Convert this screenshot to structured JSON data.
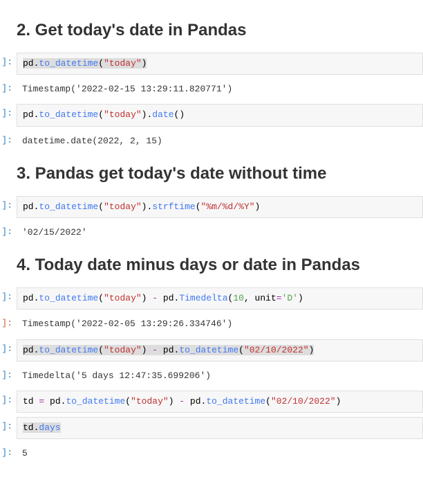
{
  "sections": [
    {
      "heading": "2. Get today's date in Pandas",
      "cells": [
        {
          "type": "in",
          "prompt": "]:",
          "highlighted": true,
          "tokens": [
            {
              "t": "pd",
              "c": "tok-k"
            },
            {
              "t": ".",
              "c": "tok-k"
            },
            {
              "t": "to_datetime",
              "c": "tok-fn"
            },
            {
              "t": "(",
              "c": "tok-k"
            },
            {
              "t": "\"today\"",
              "c": "tok-s"
            },
            {
              "t": ")",
              "c": "tok-k"
            }
          ]
        },
        {
          "type": "out",
          "prompt": "]:",
          "text": "Timestamp('2022-02-15 13:29:11.820771')"
        },
        {
          "type": "in",
          "prompt": "]:",
          "highlighted": false,
          "tokens": [
            {
              "t": "pd",
              "c": "tok-k"
            },
            {
              "t": ".",
              "c": "tok-k"
            },
            {
              "t": "to_datetime",
              "c": "tok-fn"
            },
            {
              "t": "(",
              "c": "tok-k"
            },
            {
              "t": "\"today\"",
              "c": "tok-s"
            },
            {
              "t": ")",
              "c": "tok-k"
            },
            {
              "t": ".",
              "c": "tok-k"
            },
            {
              "t": "date",
              "c": "tok-fn"
            },
            {
              "t": "()",
              "c": "tok-k"
            }
          ]
        },
        {
          "type": "out",
          "prompt": "]:",
          "text": "datetime.date(2022, 2, 15)"
        }
      ]
    },
    {
      "heading": "3. Pandas get today's date without time",
      "cells": [
        {
          "type": "in",
          "prompt": "]:",
          "highlighted": false,
          "tokens": [
            {
              "t": "pd",
              "c": "tok-k"
            },
            {
              "t": ".",
              "c": "tok-k"
            },
            {
              "t": "to_datetime",
              "c": "tok-fn"
            },
            {
              "t": "(",
              "c": "tok-k"
            },
            {
              "t": "\"today\"",
              "c": "tok-s"
            },
            {
              "t": ")",
              "c": "tok-k"
            },
            {
              "t": ".",
              "c": "tok-k"
            },
            {
              "t": "strftime",
              "c": "tok-fn"
            },
            {
              "t": "(",
              "c": "tok-k"
            },
            {
              "t": "\"%m/%d/%Y\"",
              "c": "tok-s"
            },
            {
              "t": ")",
              "c": "tok-k"
            }
          ]
        },
        {
          "type": "out",
          "prompt": "]:",
          "text": "'02/15/2022'"
        }
      ]
    },
    {
      "heading": "4. Today date minus days or date in Pandas",
      "cells": [
        {
          "type": "in",
          "prompt": "]:",
          "prompt_color": "in-blue",
          "highlighted": false,
          "tokens": [
            {
              "t": "pd",
              "c": "tok-k"
            },
            {
              "t": ".",
              "c": "tok-k"
            },
            {
              "t": "to_datetime",
              "c": "tok-fn"
            },
            {
              "t": "(",
              "c": "tok-k"
            },
            {
              "t": "\"today\"",
              "c": "tok-s"
            },
            {
              "t": ") ",
              "c": "tok-k"
            },
            {
              "t": "-",
              "c": "tok-op"
            },
            {
              "t": " pd",
              "c": "tok-k"
            },
            {
              "t": ".",
              "c": "tok-k"
            },
            {
              "t": "Timedelta",
              "c": "tok-fn"
            },
            {
              "t": "(",
              "c": "tok-k"
            },
            {
              "t": "10",
              "c": "tok-n"
            },
            {
              "t": ", unit",
              "c": "tok-k"
            },
            {
              "t": "=",
              "c": "tok-op"
            },
            {
              "t": "'D'",
              "c": "tok-sg"
            },
            {
              "t": ")",
              "c": "tok-k"
            }
          ]
        },
        {
          "type": "out",
          "prompt": "]:",
          "prompt_color": "out-red",
          "text": "Timestamp('2022-02-05 13:29:26.334746')"
        },
        {
          "type": "in",
          "prompt": "]:",
          "highlighted": true,
          "tokens": [
            {
              "t": "pd",
              "c": "tok-k"
            },
            {
              "t": ".",
              "c": "tok-k"
            },
            {
              "t": "to_datetime",
              "c": "tok-fn"
            },
            {
              "t": "(",
              "c": "tok-k"
            },
            {
              "t": "\"today\"",
              "c": "tok-s"
            },
            {
              "t": ") ",
              "c": "tok-k"
            },
            {
              "t": "-",
              "c": "tok-op"
            },
            {
              "t": " pd",
              "c": "tok-k"
            },
            {
              "t": ".",
              "c": "tok-k"
            },
            {
              "t": "to_datetime",
              "c": "tok-fn"
            },
            {
              "t": "(",
              "c": "tok-k"
            },
            {
              "t": "\"02/10/2022\"",
              "c": "tok-s"
            },
            {
              "t": ")",
              "c": "tok-k"
            }
          ]
        },
        {
          "type": "out",
          "prompt": "]:",
          "text": "Timedelta('5 days 12:47:35.699206')"
        },
        {
          "type": "in",
          "prompt": "]:",
          "highlighted": false,
          "tokens": [
            {
              "t": "td ",
              "c": "tok-k"
            },
            {
              "t": "=",
              "c": "tok-op"
            },
            {
              "t": " pd",
              "c": "tok-k"
            },
            {
              "t": ".",
              "c": "tok-k"
            },
            {
              "t": "to_datetime",
              "c": "tok-fn"
            },
            {
              "t": "(",
              "c": "tok-k"
            },
            {
              "t": "\"today\"",
              "c": "tok-s"
            },
            {
              "t": ") ",
              "c": "tok-k"
            },
            {
              "t": "-",
              "c": "tok-op"
            },
            {
              "t": " pd",
              "c": "tok-k"
            },
            {
              "t": ".",
              "c": "tok-k"
            },
            {
              "t": "to_datetime",
              "c": "tok-fn"
            },
            {
              "t": "(",
              "c": "tok-k"
            },
            {
              "t": "\"02/10/2022\"",
              "c": "tok-s"
            },
            {
              "t": ")",
              "c": "tok-k"
            }
          ]
        },
        {
          "type": "in",
          "prompt": "]:",
          "highlighted": true,
          "tokens": [
            {
              "t": "td",
              "c": "tok-k"
            },
            {
              "t": ".",
              "c": "tok-k"
            },
            {
              "t": "days",
              "c": "tok-fn"
            }
          ]
        },
        {
          "type": "out",
          "prompt": "]:",
          "text": "5"
        }
      ]
    }
  ]
}
